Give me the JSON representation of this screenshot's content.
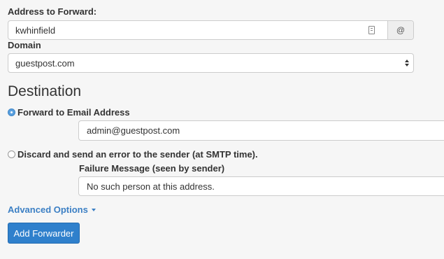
{
  "address": {
    "label": "Address to Forward:",
    "value": "kwhinfield",
    "addon": "@"
  },
  "domain": {
    "label": "Domain",
    "selected": "guestpost.com"
  },
  "destination": {
    "heading": "Destination",
    "forward": {
      "label": "Forward to Email Address",
      "value": "admin@guestpost.com",
      "checked": true
    },
    "discard": {
      "label": "Discard and send an error to the sender (at SMTP time).",
      "failure_label": "Failure Message (seen by sender)",
      "failure_value": "No such person at this address.",
      "checked": false
    }
  },
  "advanced_options": "Advanced Options",
  "submit_label": "Add Forwarder",
  "colors": {
    "accent": "#2f80cc",
    "link": "#3b7fc4",
    "background": "#f6f6f6",
    "text": "#333333"
  }
}
